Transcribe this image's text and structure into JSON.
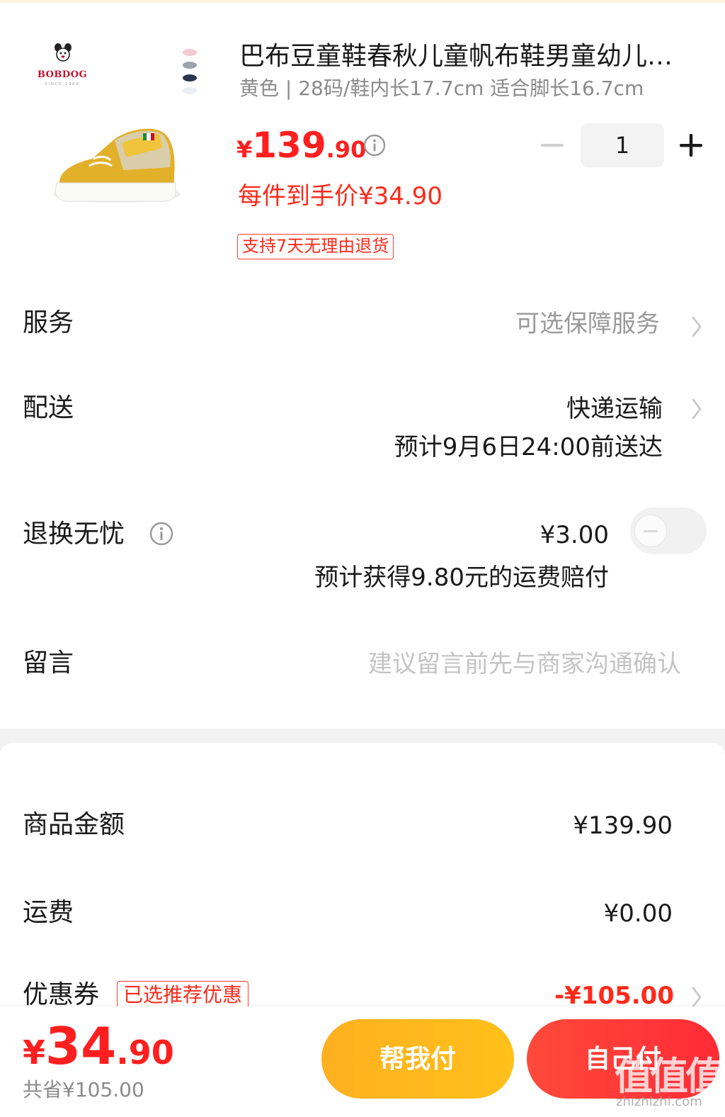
{
  "product": {
    "brand": "BOBDOG",
    "brand_since": "SINCE 1988",
    "title": "巴布豆童鞋春秋儿童帆布鞋男童幼儿…",
    "spec": "黄色 | 28码/鞋内长17.7cm 适合脚长16.7cm",
    "price_symbol": "¥",
    "price_integer": "139",
    "price_decimal": ".90",
    "quantity": "1",
    "unit_price": "每件到手价¥34.90",
    "return_policy": "支持7天无理由退货"
  },
  "service": {
    "label": "服务",
    "value": "可选保障服务"
  },
  "delivery": {
    "label": "配送",
    "method": "快递运输",
    "eta": "预计9月6日24:00前送达"
  },
  "return_insurance": {
    "label": "退换无忧",
    "price": "¥3.00",
    "note": "预计获得9.80元的运费赔付",
    "enabled": false
  },
  "message": {
    "label": "留言",
    "placeholder": "建议留言前先与商家沟通确认"
  },
  "summary": {
    "goods_label": "商品金额",
    "goods_value": "¥139.90",
    "shipping_label": "运费",
    "shipping_value": "¥0.00",
    "coupon_label": "优惠券",
    "coupon_badge": "已选推荐优惠",
    "coupon_value": "-¥105.00"
  },
  "checkout": {
    "total_symbol": "¥",
    "total_integer": "34",
    "total_decimal": ".90",
    "savings": "共省¥105.00",
    "help_pay_label": "帮我付",
    "self_pay_label": "自己付"
  },
  "watermark": {
    "mark": "值值值",
    "url": "zhizhizhi.com"
  },
  "colors": {
    "price_red": "#ff1f1f",
    "accent_orange": "#ffb020",
    "accent_red": "#ff3b30",
    "muted_gray": "#9a9a9a"
  },
  "icons": [
    "info-icon",
    "minus-icon",
    "plus-icon",
    "chevron-right-icon",
    "toggle-switch"
  ]
}
